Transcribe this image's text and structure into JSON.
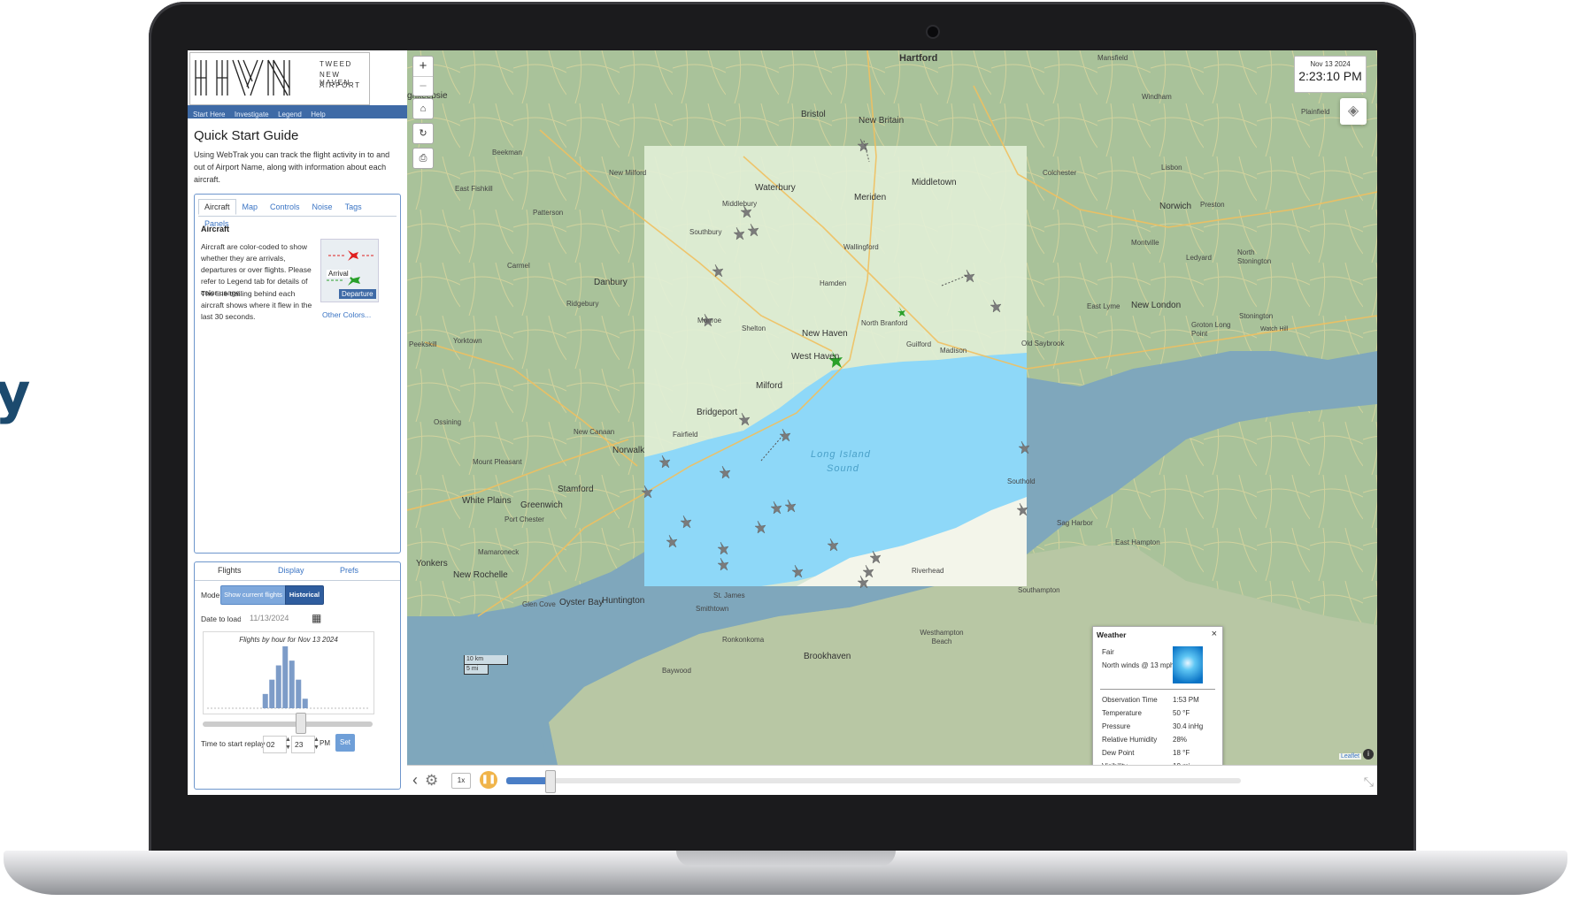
{
  "edge_fragment": "y",
  "brand": {
    "logo_letters": "HVN",
    "line1": "TWEED",
    "line2": "NEW HAVEN",
    "line3": "AIRPORT"
  },
  "nav": [
    "Start Here",
    "Investigate",
    "Legend",
    "Help"
  ],
  "quick_start": {
    "title": "Quick Start Guide",
    "description": "Using WebTrak you can track the flight activity in to and out of Airport Name, along with information about each aircraft.",
    "tabs": [
      "Aircraft",
      "Map",
      "Controls",
      "Noise",
      "Tags",
      "Panels"
    ],
    "section_title": "Aircraft",
    "text1": "Aircraft are color-coded to show whether they are arrivals, departures or over flights. Please refer to Legend tab for details of color usage.",
    "text2": "The line trailing behind each aircraft shows where it flew in the last 30 seconds.",
    "arrival_label": "Arrival",
    "departure_label": "Departure",
    "other_colors": "Other Colors..."
  },
  "flights_panel": {
    "tabs": [
      "Flights",
      "Display",
      "Prefs"
    ],
    "mode_label": "Mode",
    "btn_current": "Show current flights",
    "btn_historical": "Historical",
    "date_label": "Date to load",
    "date_value": "11/13/2024",
    "histogram_title": "Flights by hour for Nov 13 2024",
    "replay_label": "Time to start replay",
    "replay_hour": "02",
    "replay_min": "23",
    "replay_ampm": "PM",
    "set_label": "Set"
  },
  "map": {
    "clock_date": "Nov 13 2024",
    "clock_time": "2:23:10 PM",
    "water_label_1": "Long Island",
    "water_label_2": "Sound",
    "scale_km": "10 km",
    "scale_mi": "5 mi",
    "attribution": "Leaflet",
    "places": [
      {
        "name": "Hartford",
        "cls": "b"
      },
      {
        "name": "Mansfield",
        "cls": "s"
      },
      {
        "name": "Bristol",
        "cls": ""
      },
      {
        "name": "New Britain",
        "cls": ""
      },
      {
        "name": "Windham",
        "cls": "s"
      },
      {
        "name": "Plainfield",
        "cls": "s"
      },
      {
        "name": "ghkeepsie",
        "cls": ""
      },
      {
        "name": "Beekman",
        "cls": "s"
      },
      {
        "name": "New Milford",
        "cls": "s"
      },
      {
        "name": "Waterbury",
        "cls": ""
      },
      {
        "name": "Meriden",
        "cls": ""
      },
      {
        "name": "Middletown",
        "cls": ""
      },
      {
        "name": "Colchester",
        "cls": "s"
      },
      {
        "name": "Lisbon",
        "cls": "s"
      },
      {
        "name": "East Fishkill",
        "cls": "s"
      },
      {
        "name": "Middlebury",
        "cls": "s"
      },
      {
        "name": "Norwich",
        "cls": ""
      },
      {
        "name": "Preston",
        "cls": "s"
      },
      {
        "name": "Patterson",
        "cls": "s"
      },
      {
        "name": "Southbury",
        "cls": "s"
      },
      {
        "name": "Wallingford",
        "cls": "s"
      },
      {
        "name": "Montville",
        "cls": "s"
      },
      {
        "name": "Ledyard",
        "cls": "s"
      },
      {
        "name": "North Stonington",
        "cls": "s"
      },
      {
        "name": "Carmel",
        "cls": "s"
      },
      {
        "name": "Danbury",
        "cls": ""
      },
      {
        "name": "Hamden",
        "cls": "s"
      },
      {
        "name": "Ridgebury",
        "cls": "s"
      },
      {
        "name": "East Lyme",
        "cls": "s"
      },
      {
        "name": "New London",
        "cls": ""
      },
      {
        "name": "Monroe",
        "cls": "s"
      },
      {
        "name": "North Branford",
        "cls": "s"
      },
      {
        "name": "Groton Long Point",
        "cls": "s"
      },
      {
        "name": "Stonington",
        "cls": "s"
      },
      {
        "name": "Watch Hill",
        "cls": "s"
      },
      {
        "name": "Peekskill",
        "cls": "s"
      },
      {
        "name": "Yorktown",
        "cls": "s"
      },
      {
        "name": "Shelton",
        "cls": "s"
      },
      {
        "name": "New Haven",
        "cls": ""
      },
      {
        "name": "West Haven",
        "cls": ""
      },
      {
        "name": "Guilford",
        "cls": "s"
      },
      {
        "name": "Madison",
        "cls": "s"
      },
      {
        "name": "Old Saybrook",
        "cls": "s"
      },
      {
        "name": "Milford",
        "cls": ""
      },
      {
        "name": "Bridgeport",
        "cls": ""
      },
      {
        "name": "Ossining",
        "cls": "s"
      },
      {
        "name": "Fairfield",
        "cls": "s"
      },
      {
        "name": "New Canaan",
        "cls": "s"
      },
      {
        "name": "Norwalk",
        "cls": ""
      },
      {
        "name": "Mount Pleasant",
        "cls": "s"
      },
      {
        "name": "Stamford",
        "cls": ""
      },
      {
        "name": "Southold",
        "cls": "s"
      },
      {
        "name": "White Plains",
        "cls": ""
      },
      {
        "name": "Greenwich",
        "cls": ""
      },
      {
        "name": "Port Chester",
        "cls": "s"
      },
      {
        "name": "Sag Harbor",
        "cls": "s"
      },
      {
        "name": "East Hampton",
        "cls": "s"
      },
      {
        "name": "Mamaroneck",
        "cls": "s"
      },
      {
        "name": "Yonkers",
        "cls": ""
      },
      {
        "name": "New Rochelle",
        "cls": ""
      },
      {
        "name": "Riverhead",
        "cls": "s"
      },
      {
        "name": "St. James",
        "cls": "s"
      },
      {
        "name": "Glen Cove",
        "cls": "s"
      },
      {
        "name": "Oyster Bay",
        "cls": ""
      },
      {
        "name": "Huntington",
        "cls": ""
      },
      {
        "name": "Southampton",
        "cls": "s"
      },
      {
        "name": "Smithtown",
        "cls": "s"
      },
      {
        "name": "Ronkonkoma",
        "cls": "s"
      },
      {
        "name": "Westhampton Beach",
        "cls": "s"
      },
      {
        "name": "Brookhaven",
        "cls": ""
      },
      {
        "name": "Baywood",
        "cls": "s"
      }
    ]
  },
  "weather": {
    "title": "Weather",
    "condition": "Fair",
    "wind": "North winds @ 13 mph",
    "rows": [
      {
        "label": "Observation Time",
        "value": "1:53 PM"
      },
      {
        "label": "Temperature",
        "value": "50 °F"
      },
      {
        "label": "Pressure",
        "value": "30.4 inHg"
      },
      {
        "label": "Relative Humidity",
        "value": "28%"
      },
      {
        "label": "Dew Point",
        "value": "18 °F"
      },
      {
        "label": "Visibility",
        "value": "10 mi"
      }
    ]
  },
  "playback": {
    "speed": "1x",
    "progress": 0.06
  },
  "histogram": {
    "values": [
      0,
      0,
      0,
      0,
      0,
      0,
      0,
      0,
      3,
      6,
      9,
      13,
      10,
      6,
      2,
      0,
      0,
      0,
      0,
      0,
      0,
      0,
      0,
      0
    ]
  },
  "colors": {
    "accent": "#3e6aa6",
    "arrival": "#e02020",
    "departure": "#2aa02a",
    "water": "#8ed8f8"
  }
}
